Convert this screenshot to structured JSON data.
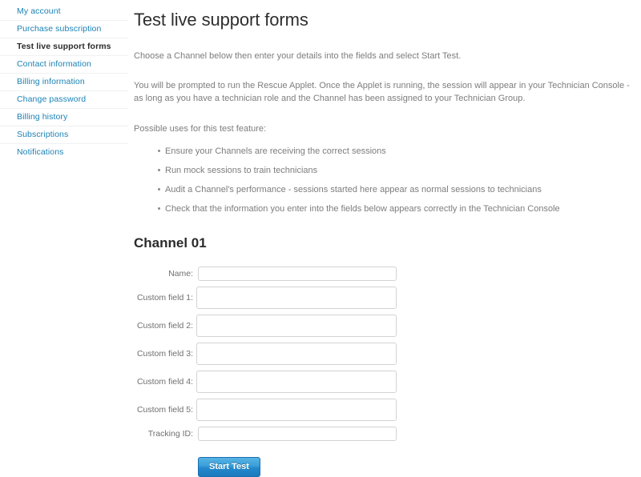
{
  "sidebar": {
    "items": [
      {
        "label": "My account",
        "active": false
      },
      {
        "label": "Purchase subscription",
        "active": false
      },
      {
        "label": "Test live support forms",
        "active": true
      },
      {
        "label": "Contact information",
        "active": false
      },
      {
        "label": "Billing information",
        "active": false
      },
      {
        "label": "Change password",
        "active": false
      },
      {
        "label": "Billing history",
        "active": false
      },
      {
        "label": "Subscriptions",
        "active": false
      },
      {
        "label": "Notifications",
        "active": false
      }
    ]
  },
  "main": {
    "title": "Test live support forms",
    "intro_paragraph": "Choose a Channel below then enter your details into the fields and select Start Test.",
    "applet_paragraph": "You will be prompted to run the Rescue Applet. Once the Applet is running, the session will appear in your Technician Console - as long as you have a technician role and the Channel has been assigned to your Technician Group.",
    "uses_intro": "Possible uses for this test feature:",
    "uses": [
      "Ensure your Channels are receiving the correct sessions",
      "Run mock sessions to train technicians",
      "Audit a Channel's performance - sessions started here appear as normal sessions to technicians",
      "Check that the information you enter into the fields below appears correctly in the Technician Console"
    ],
    "channel_title": "Channel 01",
    "form": {
      "fields": [
        {
          "label": "Name:",
          "value": "",
          "size": "short"
        },
        {
          "label": "Custom field 1:",
          "value": "",
          "size": "tall"
        },
        {
          "label": "Custom field 2:",
          "value": "",
          "size": "tall"
        },
        {
          "label": "Custom field 3:",
          "value": "",
          "size": "tall"
        },
        {
          "label": "Custom field 4:",
          "value": "",
          "size": "tall"
        },
        {
          "label": "Custom field 5:",
          "value": "",
          "size": "tall"
        },
        {
          "label": "Tracking ID:",
          "value": "",
          "size": "short"
        }
      ],
      "submit_label": "Start Test"
    }
  },
  "colors": {
    "link": "#1b82b5",
    "active_text": "#2b2b2b",
    "body_text": "#7d7d7d",
    "button_top": "#57b3e4",
    "button_bottom": "#1c79bd",
    "input_border": "#d3d3d3",
    "separator": "#eef1f2"
  }
}
